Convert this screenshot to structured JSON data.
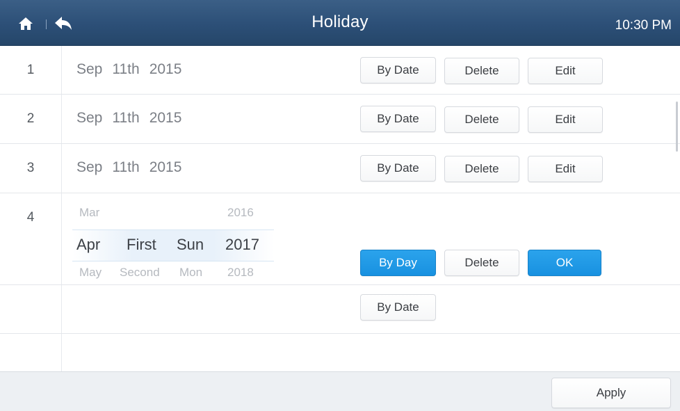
{
  "header": {
    "title": "Holiday",
    "time": "10:30 PM",
    "home_icon": "home-icon",
    "back_icon": "back-arrow-icon",
    "bg_color": "#2c4f77"
  },
  "rows": [
    {
      "num": "1",
      "month": "Sep",
      "day": "11th",
      "year": "2015",
      "mode_label": "By Date",
      "delete_label": "Delete",
      "edit_label": "Edit"
    },
    {
      "num": "2",
      "month": "Sep",
      "day": "11th",
      "year": "2015",
      "mode_label": "By Date",
      "delete_label": "Delete",
      "edit_label": "Edit"
    },
    {
      "num": "3",
      "month": "Sep",
      "day": "11th",
      "year": "2015",
      "mode_label": "By Date",
      "delete_label": "Delete",
      "edit_label": "Edit"
    }
  ],
  "editing_row": {
    "num": "4",
    "picker": {
      "above": {
        "month": "Mar",
        "week": "",
        "weekday": "",
        "year": "2016"
      },
      "selected": {
        "month": "Apr",
        "week": "First",
        "weekday": "Sun",
        "year": "2017"
      },
      "below": {
        "month": "May",
        "week": "Second",
        "weekday": "Mon",
        "year": "2018"
      }
    },
    "by_day_label": "By Day",
    "delete_label": "Delete",
    "ok_label": "OK",
    "by_date_label": "By Date",
    "accent_color": "#1891e0"
  },
  "footer": {
    "apply_label": "Apply"
  }
}
